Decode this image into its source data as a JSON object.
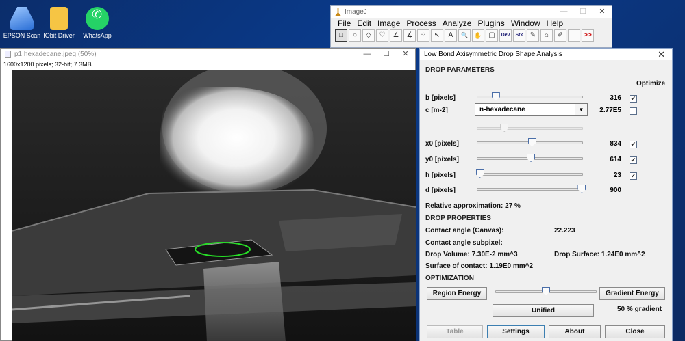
{
  "desktop": {
    "icons": [
      {
        "label": "EPSON Scan"
      },
      {
        "label": "IObit Driver Booster PR"
      },
      {
        "label": "WhatsApp"
      }
    ]
  },
  "imagej": {
    "title": "ImageJ",
    "menu": [
      "File",
      "Edit",
      "Image",
      "Process",
      "Analyze",
      "Plugins",
      "Window",
      "Help"
    ],
    "tools": [
      "□",
      "○",
      "◇",
      "♡",
      "∠",
      "∡",
      "⁘",
      "↖",
      "A",
      "🔍",
      "✋",
      "▢",
      "Dev",
      "Stk",
      "✎",
      "⌂",
      "✐",
      "",
      ">>"
    ]
  },
  "image_window": {
    "title": "p1 hexadecane.jpeg (50%)",
    "info": "1600x1200 pixels; 32-bit; 7.3MB"
  },
  "dialog": {
    "title": "Low Bond Axisymmetric Drop Shape Analysis",
    "drop_parameters": "DROP PARAMETERS",
    "optimize": "Optimize",
    "params": {
      "b": {
        "label": "b [pixels]",
        "value": "316",
        "slider": 0.18,
        "checked": true
      },
      "c": {
        "label": "c [m-2]",
        "value": "2.77E5",
        "fluid": "n-hexadecane",
        "slider": 0.26,
        "checked": false
      },
      "x0": {
        "label": "x0 [pixels]",
        "value": "834",
        "slider": 0.52,
        "checked": true
      },
      "y0": {
        "label": "y0 [pixels]",
        "value": "614",
        "slider": 0.51,
        "checked": true
      },
      "h": {
        "label": "h [pixels]",
        "value": "23",
        "slider": 0.03,
        "checked": true
      },
      "d": {
        "label": "d [pixels]",
        "value": "900",
        "slider": 0.99
      }
    },
    "relative_approx": "Relative approximation: 27 %",
    "drop_properties": "DROP PROPERTIES",
    "contact_angle_label": "Contact angle (Canvas):",
    "contact_angle_value": "22.223",
    "contact_angle_subpixel": "Contact angle subpixel:",
    "drop_volume": "Drop Volume: 7.30E-2 mm^3",
    "drop_surface": "Drop Surface: 1.24E0 mm^2",
    "surface_contact": "Surface of contact: 1.19E0 mm^2",
    "optimization": "OPTIMIZATION",
    "region_energy": "Region Energy",
    "gradient_energy": "Gradient Energy",
    "opt_slider": 0.5,
    "unified": "Unified",
    "gradient_pct": "50 % gradient",
    "buttons": {
      "table": "Table",
      "settings": "Settings",
      "about": "About",
      "close": "Close"
    }
  }
}
